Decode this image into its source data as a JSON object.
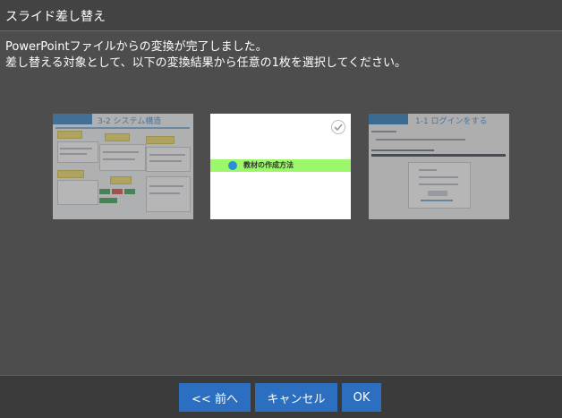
{
  "dialog": {
    "title": "スライド差し替え",
    "message_line1": "PowerPointファイルからの変換が完了しました。",
    "message_line2": "差し替える対象として、以下の変換結果から任意の1枚を選択してください。"
  },
  "thumbnails": [
    {
      "heading": "3-2 システム構造",
      "selected": false
    },
    {
      "heading": "教材の作成方法",
      "selected": true
    },
    {
      "heading": "1-1 ログインをする",
      "selected": false
    }
  ],
  "buttons": {
    "prev": "<< 前へ",
    "cancel": "キャンセル",
    "ok": "OK"
  },
  "colors": {
    "background": "#4d4d4d",
    "titlebar": "#434343",
    "footer": "#3b3b3b",
    "button": "#2c6fc0",
    "highlight_band": "#9cf76a"
  }
}
